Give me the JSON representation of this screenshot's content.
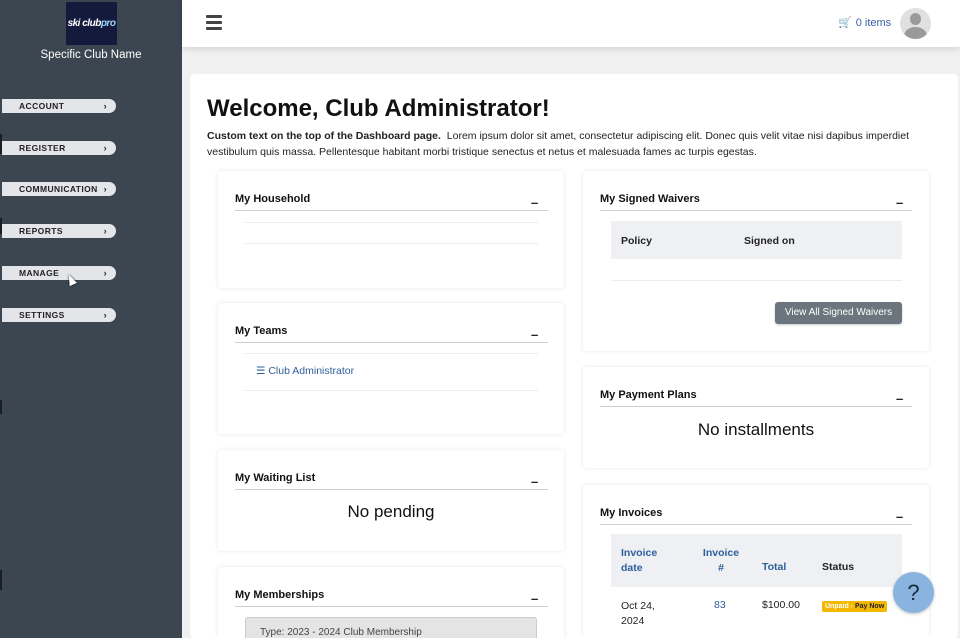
{
  "sidebar": {
    "logo_text_a": "ski club",
    "logo_text_b": "pro",
    "club_name": "Specific Club Name",
    "menu": [
      {
        "label": "ACCOUNT"
      },
      {
        "label": "REGISTER"
      },
      {
        "label": "COMMUNICATION"
      },
      {
        "label": "REPORTS"
      },
      {
        "label": "MANAGE"
      },
      {
        "label": "SETTINGS"
      }
    ],
    "chevron": "›"
  },
  "topbar": {
    "cart_icon": "🛒",
    "cart_label": "0 items"
  },
  "main": {
    "welcome": "Welcome, Club Administrator!",
    "intro_bold": "Custom text on the top of the Dashboard page.",
    "intro_text": "Lorem ipsum dolor sit amet, consectetur adipiscing elit. Donec quis velit vitae nisi dapibus imperdiet vestibulum quis massa. Pellentesque habitant morbi tristique senectus et netus et malesuada fames ac turpis egestas."
  },
  "cards": {
    "collapse_symbol": "–",
    "household": {
      "title": "My Household"
    },
    "teams": {
      "title": "My Teams",
      "team_icon": "☰",
      "team_name": "Club Administrator"
    },
    "waiting": {
      "title": "My Waiting List",
      "message": "No pending"
    },
    "memberships": {
      "title": "My Memberships",
      "item": "Type: 2023 - 2024 Club Membership"
    },
    "waivers": {
      "title": "My Signed Waivers",
      "columns": [
        "Policy",
        "Signed on"
      ],
      "button": "View All Signed Waivers"
    },
    "payment_plans": {
      "title": "My Payment Plans",
      "message": "No installments"
    },
    "invoices": {
      "title": "My Invoices",
      "columns": [
        "Invoice date",
        "Invoice #",
        "Total",
        "Status"
      ],
      "rows": [
        {
          "date": "Oct 24, 2024",
          "number": "83",
          "total": "$100.00",
          "status_a": "Unpaid",
          "status_sep": " - ",
          "status_b": "Pay Now"
        }
      ]
    }
  },
  "help": {
    "label": "?"
  }
}
